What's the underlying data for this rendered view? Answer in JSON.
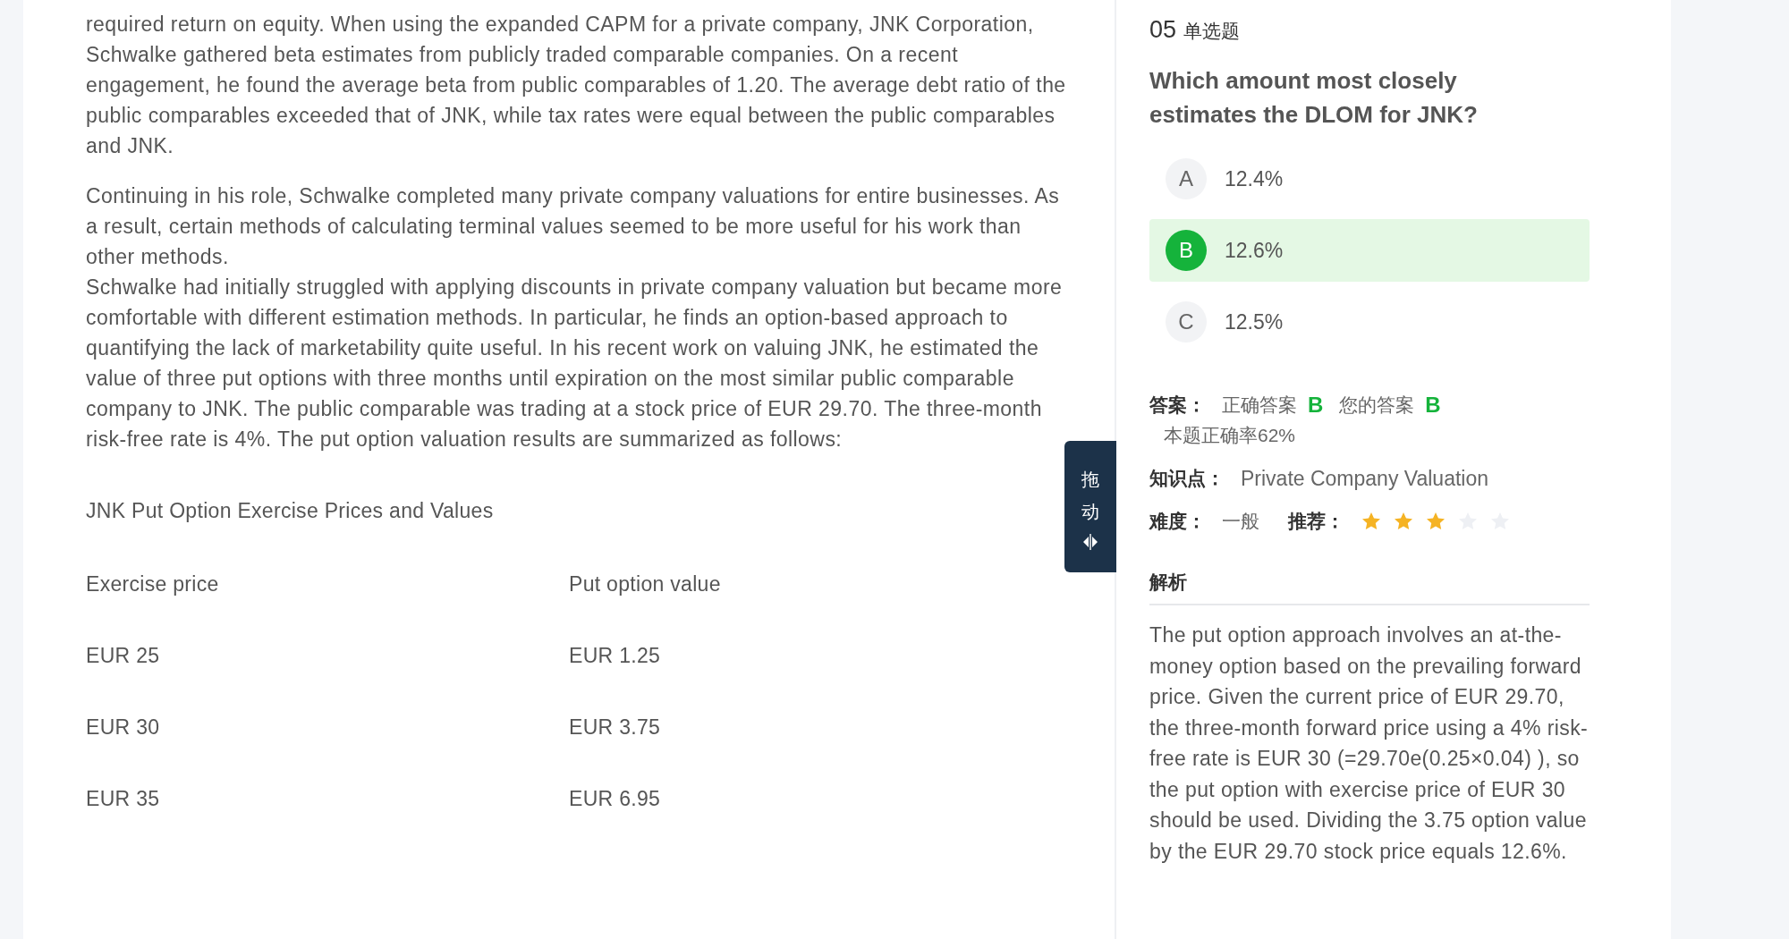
{
  "passage": {
    "paragraphs": [
      {
        "blocks": [
          "required return on equity. When using the expanded CAPM for a private company, JNK Corporation, Schwalke gathered beta estimates from publicly traded comparable companies. On a recent engagement, he found the average beta from public comparables of 1.20. The average debt ratio of the public comparables exceeded that of JNK, while tax rates were equal between the public comparables and JNK."
        ]
      },
      {
        "blocks": [
          "Continuing in his role, Schwalke completed many private company valuations for entire businesses. As a result, certain methods of calculating terminal values seemed to be more useful for his work than other methods.",
          "Schwalke had initially struggled with applying discounts in private company valuation but became more comfortable with different estimation methods. In particular, he finds an option-based approach to quantifying the lack of marketability quite useful. In his recent work on valuing JNK, he estimated the value of three put options with three months until expiration on the most similar public comparable company to JNK. The public comparable was trading at a stock price of EUR 29.70. The three-month risk-free rate is 4%. The put option valuation results are summarized as follows:"
        ]
      }
    ]
  },
  "table": {
    "caption": "JNK Put Option Exercise Prices and Values",
    "columns": [
      "Exercise price",
      "Put option value"
    ],
    "rows": [
      [
        "EUR 25",
        "EUR 1.25"
      ],
      [
        "EUR 30",
        "EUR 3.75"
      ],
      [
        "EUR 35",
        "EUR 6.95"
      ]
    ]
  },
  "drag_handle": {
    "label": "拖动"
  },
  "question": {
    "number": "05",
    "type": "单选题",
    "text": "Which amount most closely estimates the DLOM for JNK?",
    "options": [
      {
        "letter": "A",
        "text": "12.4%",
        "selected": false
      },
      {
        "letter": "B",
        "text": "12.6%",
        "selected": true
      },
      {
        "letter": "C",
        "text": "12.5%",
        "selected": false
      }
    ]
  },
  "answer": {
    "label": "答案：",
    "correct_label": "正确答案",
    "correct": "B",
    "yours_label": "您的答案",
    "yours": "B",
    "rate": "本题正确率62%"
  },
  "knowledge": {
    "label": "知识点：",
    "value": "Private Company Valuation"
  },
  "difficulty": {
    "label": "难度：",
    "value": "一般"
  },
  "recommend": {
    "label": "推荐：",
    "stars": 3
  },
  "analysis": {
    "title": "解析",
    "text": "The put option approach involves an at-the-money option based on the prevailing forward price. Given the current price of EUR 29.70, the three-month forward price using a 4% risk-free rate is EUR 30 (=29.70e(0.25×0.04) ), so the put option with exercise price of EUR 30 should be used. Dividing the 3.75 option value by the EUR 29.70 stock price equals 12.6%."
  }
}
